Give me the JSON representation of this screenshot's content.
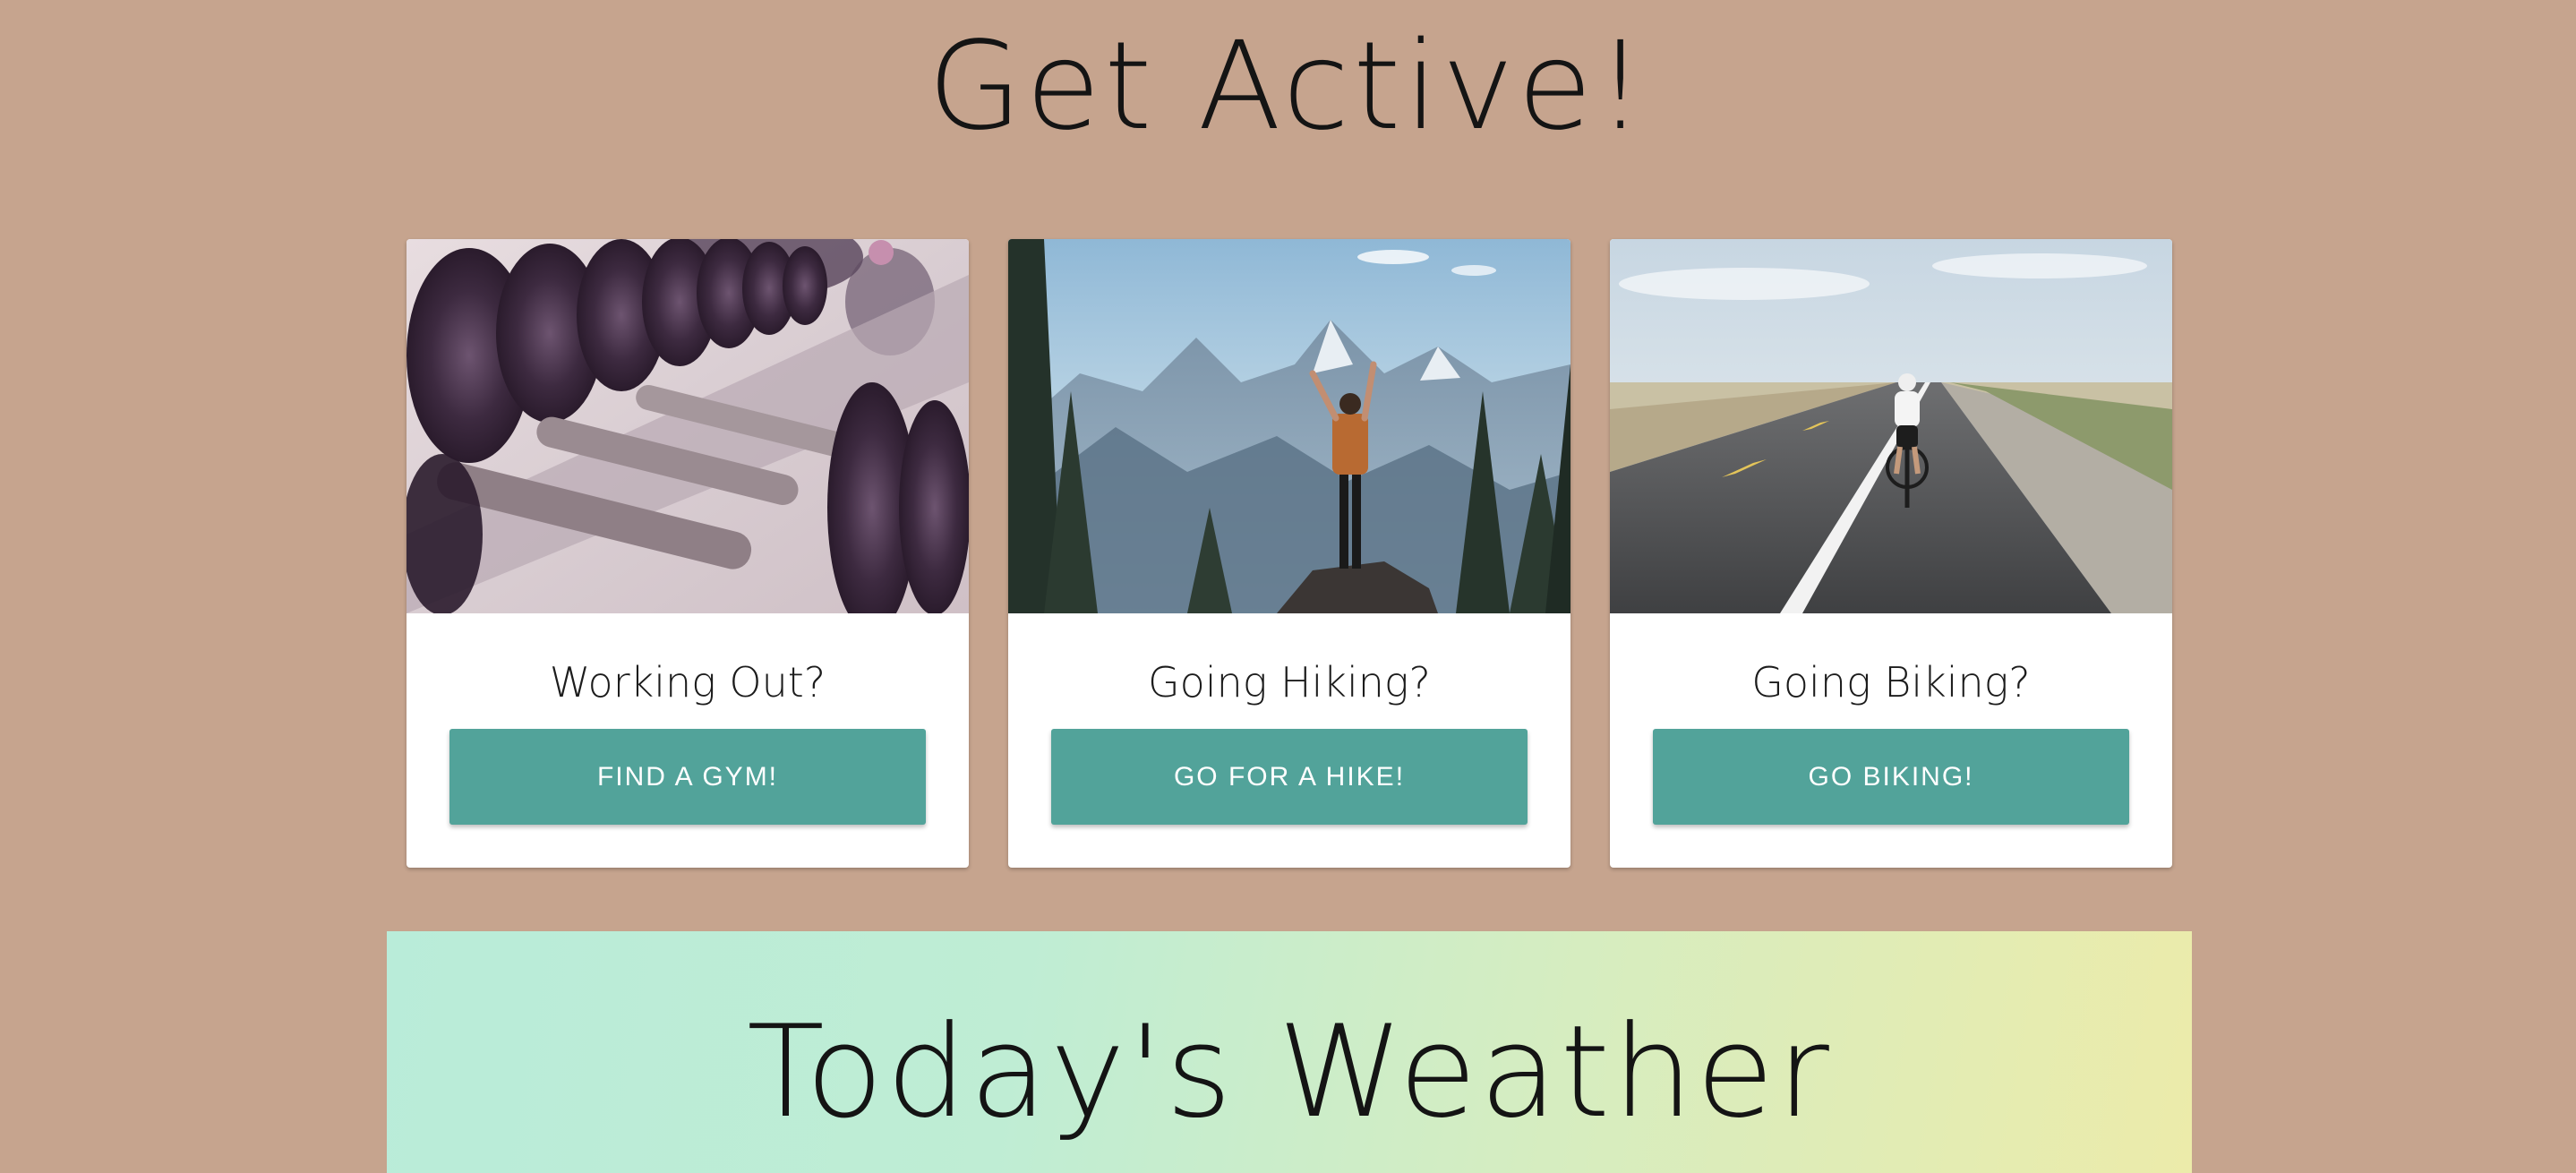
{
  "page": {
    "title": "Get Active!",
    "background_color": "#c6a48e"
  },
  "cards": [
    {
      "image_icon": "dumbbell-rack-photo",
      "heading": "Working Out?",
      "button_label": "FIND A GYM!"
    },
    {
      "image_icon": "mountain-hiker-photo",
      "heading": "Going Hiking?",
      "button_label": "GO FOR A HIKE!"
    },
    {
      "image_icon": "road-cyclist-photo",
      "heading": "Going Biking?",
      "button_label": "GO BIKING!"
    }
  ],
  "button_color": "#52a39a",
  "weather": {
    "title": "Today's Weather"
  }
}
